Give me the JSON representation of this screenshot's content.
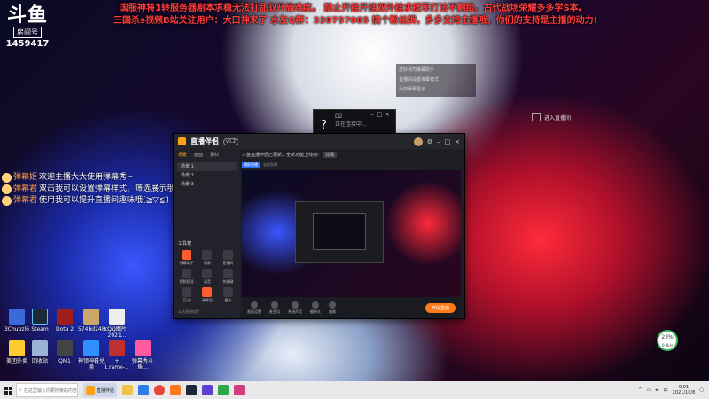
{
  "overlay": {
    "platform_logo": "斗鱼",
    "room_label": "房间号",
    "room_id": "1459417",
    "announcement_1": "国服神将1转服务器剧本求稳无法打乱取开局难度。 禁止开挂开挂双外挂求援军打法不剩给。古代战场荣耀多多学S本。",
    "announcement_2": "三国杀s视频B站关注用户：大口神来了  水友Q群：339757085  搞个粉丝牌，多多支持主播哦，你们的支持是主播的动力!"
  },
  "chat": [
    {
      "name": "弹幕姬",
      "message": "欢迎主播大大使用弹幕秀~"
    },
    {
      "name": "弹幕君",
      "message": "双击我可以设置弹幕样式，筛选展示哦~"
    },
    {
      "name": "弹幕君",
      "message": "使用我可以提升直播间趣味哦(≧▽≦)"
    }
  ],
  "popup_menu": [
    "您好我司弹幕助手",
    "直播间设置弹幕样式",
    "添加弹幕显示"
  ],
  "join_bar": {
    "label": "进入直播间"
  },
  "mini_window": {
    "title": "D2",
    "subtitle": "正在连接中..."
  },
  "app": {
    "brand": "直播伴侣",
    "version": "v5.2",
    "side_tabs": [
      "场景",
      "画面",
      "素材"
    ],
    "scenes": [
      "场景 1",
      "场景 2",
      "场景 3"
    ],
    "tools_label": "工具箱",
    "tools": [
      "弹幕助手",
      "录屏",
      "直播间",
      "视频投屏",
      "语音",
      "快捷键",
      "互动",
      "弹幕君",
      "更多"
    ],
    "footer": "斗鱼直播伴侣",
    "notice": "斗鱼直播伴侣已更新，全新功能上线啦!",
    "notice_chip": "详情",
    "preview_tabs": [
      "横屏直播",
      "竖屏直播"
    ],
    "bottom_buttons": [
      "画面设置",
      "麦克风",
      "系统声音",
      "摄像头",
      "美颜"
    ],
    "start_button": "开始直播"
  },
  "desktop_icons": [
    {
      "label": "3Chubzl6",
      "color": "#3a6ad9"
    },
    {
      "label": "Steam",
      "color": "#1b2838"
    },
    {
      "label": "Dota 2",
      "color": "#a01d1d"
    },
    {
      "label": "574bd248c...",
      "color": "#c9a86a"
    },
    {
      "label": "QQ图片2021...",
      "color": "#eeeeee"
    },
    {
      "label": "美团外卖",
      "color": "#ffcb2f"
    },
    {
      "label": "回收站",
      "color": "#9ab3d6"
    },
    {
      "label": "QM1",
      "color": "#444444"
    },
    {
      "label": "神领神鞋兑换",
      "color": "#2f8fff"
    },
    {
      "label": "+ 1.rame-...",
      "color": "#c02f2f"
    },
    {
      "label": "弹幕秀斗鱼...",
      "color": "#ff5aa0"
    }
  ],
  "badge": {
    "value": "23%",
    "sub": "0.9k/s"
  },
  "taskbar": {
    "search_placeholder": "在这里输入你要搜索的内容",
    "active_app": "直播伴侣",
    "time": "9:01",
    "date": "2021/10/8",
    "lang": "中"
  }
}
